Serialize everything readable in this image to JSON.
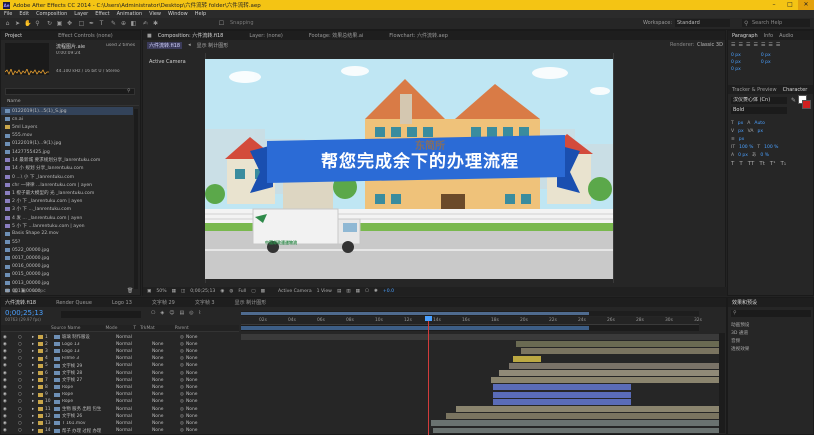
{
  "titlebar": {
    "title": "Adobe After Effects CC 2014 - C:\\Users\\Administrator\\Desktop\\六件流转 folder\\六件流转.aep",
    "app_icon": "Ae"
  },
  "menu": [
    "File",
    "Edit",
    "Composition",
    "Layer",
    "Effect",
    "Animation",
    "View",
    "Window",
    "Help"
  ],
  "toolbar": {
    "snapping_label": "Snapping",
    "workspace_label": "Workspace:",
    "workspace_value": "Standard",
    "search_placeholder": "Search Help"
  },
  "project": {
    "tabs": [
      "Project",
      "Effect Controls (none)"
    ],
    "preview_name": "流程图片.aie",
    "preview_used": "used 2 times",
    "preview_duration": "0:00:09:24",
    "preview_info": "44.100 kHz / 16 bit U / Stereo",
    "column_name": "Name",
    "items": [
      {
        "name": "0122019(1)...5(1)_S.jpg",
        "type": "file"
      },
      {
        "name": "cn.ai",
        "type": "file"
      },
      {
        "name": "5ml Layers",
        "type": "folder"
      },
      {
        "name": "555.mov",
        "type": "file"
      },
      {
        "name": "0122019(1)...9(1).jpg",
        "type": "file"
      },
      {
        "name": "1427755425.jpg",
        "type": "file"
      },
      {
        "name": "14 最新城 要求规划分享_lanrentuku.com",
        "type": "comp"
      },
      {
        "name": "14 小 规划 分享_lanrentuku.com",
        "type": "comp"
      },
      {
        "name": "0 ...\\ 小 下 _lanrentuku.com",
        "type": "comp"
      },
      {
        "name": "chr   一律律    ...lanrentuku.com | ayen",
        "type": "comp"
      },
      {
        "name": "1 橙子最大模型的 光 _lanrentuku.com",
        "type": "comp"
      },
      {
        "name": "2 小 下 _lanrentuku.com | ayen",
        "type": "comp"
      },
      {
        "name": "3 小 下 ..._lanrentuku.com",
        "type": "comp"
      },
      {
        "name": "4 发 ... _lanrentuku.com | ayen",
        "type": "comp"
      },
      {
        "name": "5 小 下 ...lanrentuku.com | ayen",
        "type": "comp"
      },
      {
        "name": "Basis Shape 22.mov",
        "type": "file"
      },
      {
        "name": "55?",
        "type": "file"
      },
      {
        "name": "0522_00000.jpg",
        "type": "file"
      },
      {
        "name": "0017_00000.jpg",
        "type": "file"
      },
      {
        "name": "0016_00000.jpg",
        "type": "file"
      },
      {
        "name": "0015_00000.jpg",
        "type": "file"
      },
      {
        "name": "0013_00000.jpg",
        "type": "file"
      },
      {
        "name": "0017_00000",
        "type": "file"
      }
    ],
    "bpc": "8 bpc"
  },
  "comp": {
    "tab_label": "Composition: 六件流转.fi18",
    "other_tabs": [
      "Layer: (none)",
      "Footage: 效果总结果.ai",
      "Flowchart: 六件流转.aep"
    ],
    "breadcrumbs": [
      "六件流转.fi18",
      "显示 制计图形"
    ],
    "renderer_label": "Renderer:",
    "renderer_value": "Classic 3D",
    "active_camera": "Active Camera",
    "banner_text": "帮您完成余下的办理流程",
    "sign_text": "东简所",
    "truck_text": "中国邮政速递物流",
    "zoom": "50%",
    "timecode": "0;00;25;13",
    "resolution": "Full",
    "view_label": "Active Camera",
    "views": "1 View",
    "exposure": "+0.0"
  },
  "right": {
    "tabs_top": [
      "Paragraph",
      "Info",
      "Audio"
    ],
    "indent_values": [
      "0 px",
      "0 px",
      "0 px",
      "0 px",
      "0 px"
    ],
    "tabs_mid": [
      "Tracker & Preview",
      "Character"
    ],
    "font_name": "汉仪菱心体 (Cn)",
    "font_style": "Bold",
    "font_size": "px",
    "tracking": "Auto",
    "px_labels": [
      "px",
      "px",
      "px"
    ],
    "percent": [
      "100 %",
      "100 %"
    ],
    "shift": "0 px",
    "tsume": "0 %"
  },
  "timeline": {
    "tabs": [
      "六件流转.fi18",
      "Render Queue",
      "Logo 13",
      "文字帧 29",
      "文字帧 3",
      "显示 制计图形"
    ],
    "timecode": "0;00;25;13",
    "frames": "00763 (29.97 fps)",
    "columns": [
      "Source Name",
      "Mode",
      "T",
      "TrkMat",
      "Parent"
    ],
    "ruler": [
      "02s",
      "04s",
      "06s",
      "08s",
      "10s",
      "12s",
      "14s",
      "16s",
      "18s",
      "20s",
      "22s",
      "24s",
      "26s",
      "28s",
      "30s",
      "32s"
    ],
    "layers": [
      {
        "num": "1",
        "name": "玻璃 制作服设",
        "mode": "Normal",
        "trk": "",
        "parent": "None",
        "color": "#3a3a3a"
      },
      {
        "num": "2",
        "name": "Logo 13",
        "mode": "Normal",
        "trk": "None",
        "parent": "None",
        "color": "#6a6a52"
      },
      {
        "num": "3",
        "name": "Logo 13",
        "mode": "Normal",
        "trk": "None",
        "parent": "None",
        "color": "#7a7460"
      },
      {
        "num": "4",
        "name": "Fillme 3",
        "mode": "Normal",
        "trk": "None",
        "parent": "None",
        "color": "#bba842"
      },
      {
        "num": "5",
        "name": "文字帧 29",
        "mode": "Normal",
        "trk": "None",
        "parent": "None",
        "color": "#7a7368"
      },
      {
        "num": "6",
        "name": "文字帧 28",
        "mode": "Normal",
        "trk": "None",
        "parent": "None",
        "color": "#908a78"
      },
      {
        "num": "7",
        "name": "文字帧 27",
        "mode": "Normal",
        "trk": "None",
        "parent": "None",
        "color": "#8a846e"
      },
      {
        "num": "8",
        "name": "Rope",
        "mode": "Normal",
        "trk": "None",
        "parent": "None",
        "color": "#5a6cb8"
      },
      {
        "num": "9",
        "name": "Rope",
        "mode": "Normal",
        "trk": "None",
        "parent": "None",
        "color": "#5a6cb8"
      },
      {
        "num": "10",
        "name": "Rope",
        "mode": "Normal",
        "trk": "None",
        "parent": "None",
        "color": "#5a6cb8"
      },
      {
        "num": "11",
        "name": "生物 服务 出租 包生",
        "mode": "Normal",
        "trk": "None",
        "parent": "None",
        "color": "#8a846e"
      },
      {
        "num": "12",
        "name": "文字帧 26",
        "mode": "Normal",
        "trk": "None",
        "parent": "None",
        "color": "#7a7460"
      },
      {
        "num": "13",
        "name": "T 161.mov",
        "mode": "Normal",
        "trk": "None",
        "parent": "None",
        "color": "#6a7270"
      },
      {
        "num": "14",
        "name": "帮子 办理 过程 办理",
        "mode": "Normal",
        "trk": "None",
        "parent": "None",
        "color": "#6a7270"
      }
    ],
    "toggle_label": "Toggle Switches / Modes"
  },
  "effects": {
    "title": "效果和预设",
    "search": "",
    "items": [
      "动画预设",
      "3D 通道",
      "音频",
      "透视效果"
    ]
  }
}
